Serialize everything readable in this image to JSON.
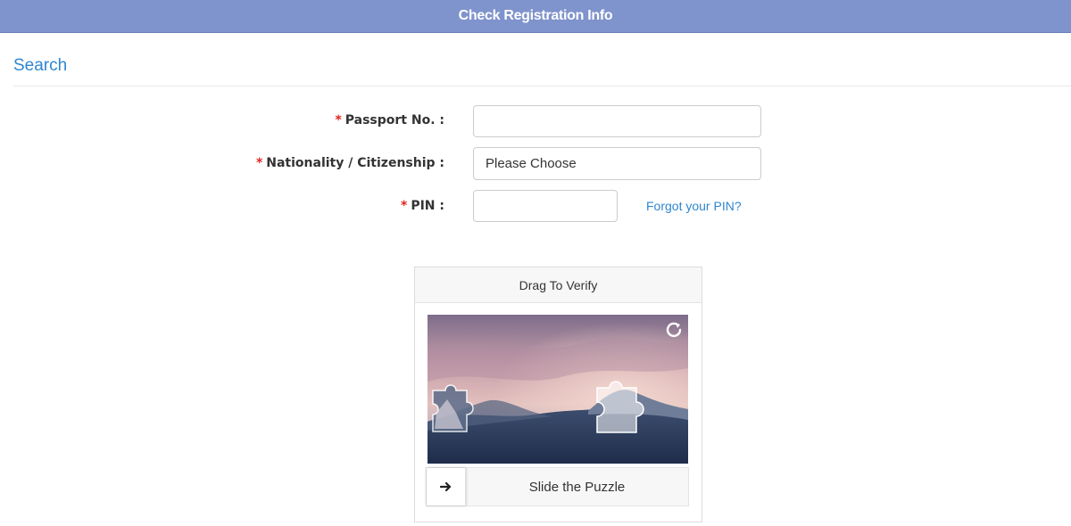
{
  "header": {
    "title": "Check Registration Info"
  },
  "section": {
    "title": "Search"
  },
  "form": {
    "passport": {
      "required_mark": "*",
      "label": "Passport No. :",
      "value": "",
      "placeholder": ""
    },
    "nationality": {
      "required_mark": "*",
      "label": "Nationality / Citizenship :",
      "selected": "Please Choose"
    },
    "pin": {
      "required_mark": "*",
      "label": "PIN :",
      "value": "",
      "placeholder": ""
    },
    "forgot_link": "Forgot your PIN?"
  },
  "captcha": {
    "title": "Drag To Verify",
    "slider_label": "Slide the Puzzle",
    "refresh_icon": "refresh-icon",
    "handle_icon": "arrow-right-icon",
    "slider_position": 0
  },
  "colors": {
    "header_bg": "#7f93cc",
    "accent": "#2f86cf",
    "required": "#e0251e"
  }
}
